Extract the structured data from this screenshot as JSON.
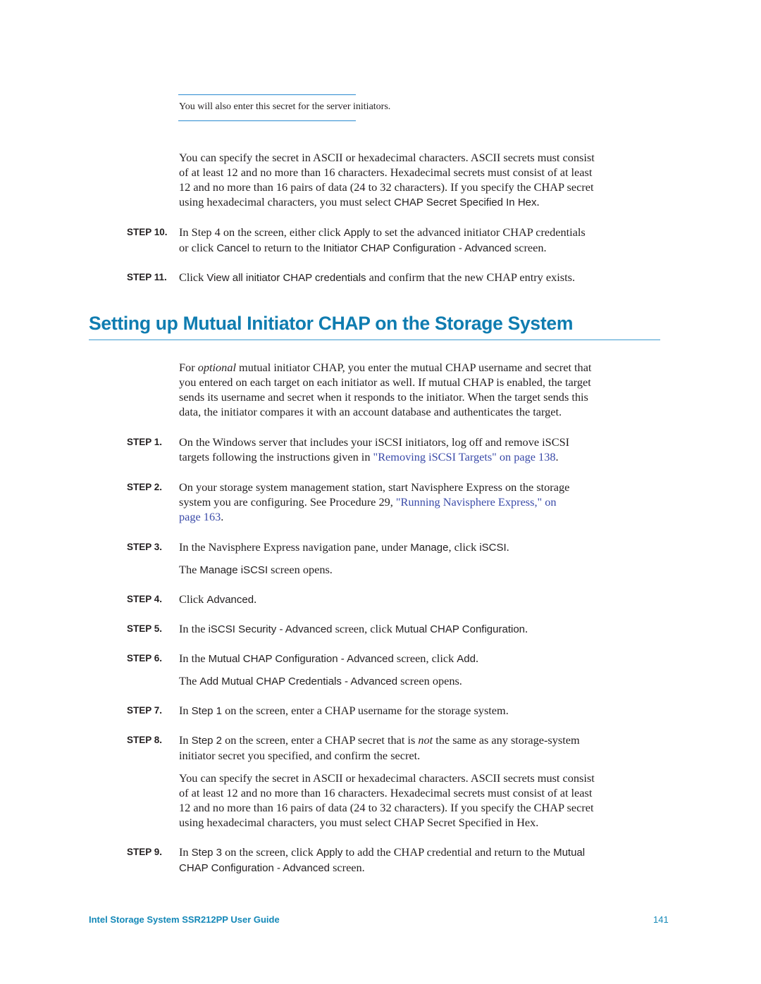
{
  "note": {
    "text": "You will also enter this secret for the server initiators."
  },
  "top_section": {
    "secret_paragraph": {
      "lines": [
        "You can specify the secret in ASCII or hexadecimal characters. ASCII secrets must consist",
        "of at least 12 and no more than 16 characters. Hexadecimal secrets must consist of at least",
        "12 and no more than 16 pairs of data (24 to 32 characters). If you specify the CHAP secret"
      ],
      "last_line_prefix": "using hexadecimal characters, you must select ",
      "last_line_ui": "CHAP Secret Specified In Hex",
      "last_line_suffix": "."
    },
    "steps": [
      {
        "label": "STEP 10.",
        "line1": [
          "In Step 4 on the screen, either click ",
          "Apply",
          " to set the advanced initiator CHAP credentials"
        ],
        "line2": [
          "or click ",
          "Cancel",
          " to return to the ",
          "Initiator CHAP Configuration - Advanced",
          " screen."
        ]
      },
      {
        "label": "STEP 11.",
        "line1": [
          "Click ",
          "View all initiator CHAP credentials",
          " and confirm that the new CHAP entry exists."
        ]
      }
    ]
  },
  "heading": "Setting up Mutual Initiator CHAP on the Storage System",
  "intro": {
    "prefix": "For ",
    "emphasis": "optional",
    "line1_rest": " mutual initiator CHAP, you enter the mutual CHAP username and secret that",
    "lines": [
      "you entered on each target on each initiator as well. If mutual CHAP is enabled, the target",
      "sends its username and secret when it responds to the initiator. When the target sends this",
      "data, the initiator compares it with an account database and authenticates the target."
    ]
  },
  "steps": [
    {
      "label": "STEP 1.",
      "line1": "On the Windows server that includes your iSCSI initiators, log off and remove iSCSI",
      "line2_prefix": "targets following the instructions given in ",
      "line2_link": "\"Removing iSCSI Targets\" on page 138",
      "line2_suffix": "."
    },
    {
      "label": "STEP 2.",
      "line1": "On your storage system management station, start Navisphere Express on the storage",
      "line2_prefix": "system you are configuring. See Procedure 29, ",
      "line2_link": "\"Running Navisphere Express,\" on",
      "line3_link": "page 163",
      "line3_suffix": "."
    },
    {
      "label": "STEP 3.",
      "line1": [
        "In the Navisphere Express navigation pane, under ",
        "Manage",
        ", click ",
        "iSCSI",
        "."
      ],
      "result": [
        "The ",
        "Manage iSCSI",
        " screen opens."
      ]
    },
    {
      "label": "STEP 4.",
      "line1": [
        "Click ",
        "Advanced",
        "."
      ]
    },
    {
      "label": "STEP 5.",
      "line1": [
        "In the ",
        "iSCSI Security - Advanced",
        " screen, click ",
        "Mutual CHAP Configuration",
        "."
      ]
    },
    {
      "label": "STEP 6.",
      "line1": [
        "In the ",
        "Mutual CHAP Configuration - Advanced",
        " screen, click ",
        "Add",
        "."
      ],
      "result": [
        "The ",
        "Add Mutual CHAP Credentials - Advanced",
        " screen opens."
      ]
    },
    {
      "label": "STEP 7.",
      "line1": [
        "In ",
        "Step 1",
        " on the screen, enter a CHAP username for the storage system."
      ]
    },
    {
      "label": "STEP 8.",
      "line1": [
        "In ",
        "Step 2",
        " on the screen, enter a CHAP secret that is ",
        "not",
        " the same as any storage-system"
      ],
      "line2": "initiator secret you specified, and confirm the secret.",
      "note_lines": [
        "You can specify the secret in ASCII or hexadecimal characters. ASCII secrets must consist",
        "of at least 12 and no more than 16 characters. Hexadecimal secrets must consist of at least",
        "12 and no more than 16 pairs of data (24 to 32 characters). If you specify the CHAP secret",
        "using hexadecimal characters, you must select CHAP Secret Specified in Hex."
      ]
    },
    {
      "label": "STEP 9.",
      "line1": [
        "In ",
        "Step 3",
        " on the screen, click ",
        "Apply",
        " to add the CHAP credential and return to the ",
        "Mutual"
      ],
      "line2": [
        "CHAP Configuration - Advanced",
        " screen."
      ]
    }
  ],
  "footer": {
    "title": "Intel Storage System SSR212PP User Guide",
    "page_number": "141"
  },
  "colors": {
    "heading": "#0f7cb0",
    "rule": "#2a8ad0",
    "link": "#3a4aa8",
    "footer": "#1488b8",
    "text": "#231f20"
  }
}
